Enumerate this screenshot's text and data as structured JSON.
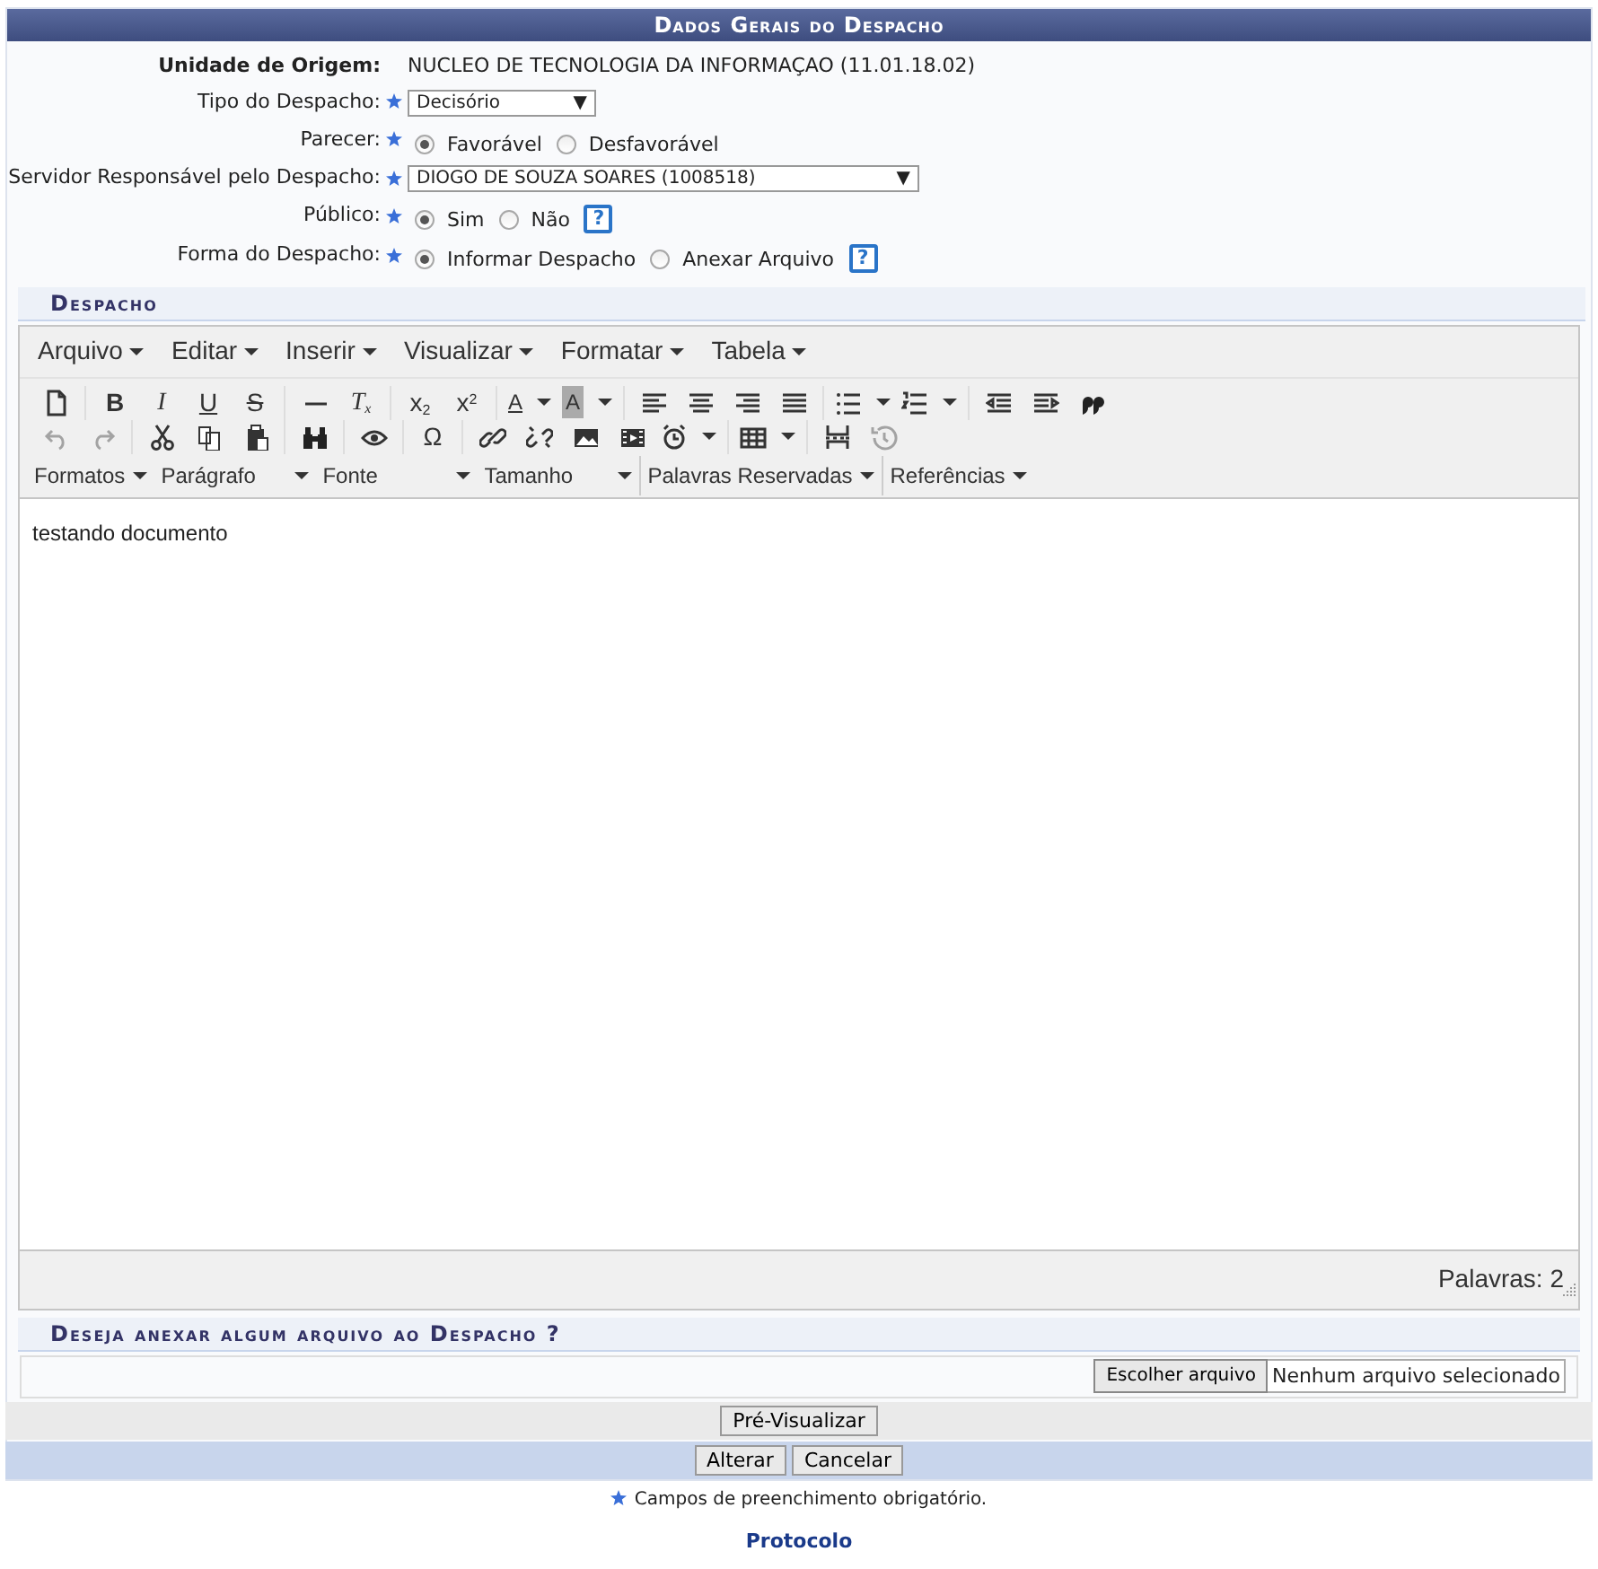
{
  "form_title": "Dados Gerais do Despacho",
  "fields": [
    {
      "label": "Unidade de Origem:",
      "kind": "text",
      "required": false,
      "value": "NUCLEO DE TECNOLOGIA DA INFORMAÇAO (11.01.18.02)"
    },
    {
      "label": "Tipo do Despacho:",
      "kind": "select",
      "required": true,
      "value": "Decisório",
      "arrow": "▼"
    },
    {
      "label": "Parecer:",
      "kind": "radio",
      "required": true,
      "options": [
        {
          "label": "Favorável",
          "selected": true
        },
        {
          "label": "Desfavorável",
          "selected": false
        }
      ],
      "help": false
    },
    {
      "label": "Servidor Responsável pelo Despacho:",
      "kind": "select",
      "required": true,
      "value": "DIOGO DE SOUZA SOARES (1008518)",
      "arrow": "▼"
    },
    {
      "label": "Público:",
      "kind": "radio",
      "required": true,
      "options": [
        {
          "label": "Sim",
          "selected": true
        },
        {
          "label": "Não",
          "selected": false
        }
      ],
      "help": true
    },
    {
      "label": "Forma do Despacho:",
      "kind": "radio",
      "required": true,
      "options": [
        {
          "label": "Informar Despacho",
          "selected": true
        },
        {
          "label": "Anexar Arquivo",
          "selected": false
        }
      ],
      "help": true
    }
  ],
  "help_mark": "?",
  "section_title": "Despacho",
  "editor": {
    "menubar": [
      "Arquivo",
      "Editar",
      "Inserir",
      "Visualizar",
      "Formatar",
      "Tabela"
    ],
    "toolbar_rows": [
      [
        [
          {
            "kind": "icon"
          }
        ],
        [
          {
            "kind": "glyph",
            "text": "B"
          },
          {
            "kind": "glyph",
            "text": "I"
          },
          {
            "kind": "glyph",
            "text": "U"
          },
          {
            "kind": "glyph",
            "text": "S"
          }
        ],
        [
          {
            "kind": "icon"
          },
          {
            "kind": "glyph",
            "text": "T$_{x}$"
          }
        ],
        [
          {
            "kind": "glyph",
            "text": "x$_{2}$"
          },
          {
            "kind": "glyph",
            "text": "x$^{2}$"
          }
        ],
        [
          {
            "kind": "glyph",
            "text": "A",
            "dropdown": true
          },
          {
            "kind": "glyph",
            "text": "A",
            "dropdown": true
          }
        ],
        [
          {
            "kind": "icon"
          },
          {
            "kind": "icon"
          },
          {
            "kind": "icon"
          },
          {
            "kind": "icon"
          }
        ],
        [
          {
            "kind": "icon",
            "dropdown": true
          },
          {
            "kind": "icon",
            "dropdown": true
          }
        ],
        [
          {
            "kind": "icon"
          },
          {
            "kind": "icon"
          },
          {
            "kind": "icon"
          }
        ]
      ],
      [
        [
          {
            "kind": "icon",
            "disabled": true
          },
          {
            "kind": "icon",
            "disabled": true
          }
        ],
        [
          {
            "kind": "icon"
          },
          {
            "kind": "icon"
          },
          {
            "kind": "icon"
          }
        ],
        [
          {
            "kind": "icon"
          }
        ],
        [
          {
            "kind": "icon"
          }
        ],
        [
          {
            "kind": "glyph",
            "text": "Ω"
          }
        ],
        [
          {
            "kind": "icon"
          },
          {
            "kind": "icon"
          },
          {
            "kind": "icon"
          },
          {
            "kind": "icon"
          },
          {
            "kind": "icon",
            "dropdown": true
          }
        ],
        [
          {
            "kind": "icon",
            "dropdown": true
          }
        ],
        [
          {
            "kind": "icon"
          },
          {
            "kind": "icon",
            "disabled": true
          }
        ]
      ]
    ],
    "format_selects": [
      {
        "label": "Formatos",
        "separator": false
      },
      {
        "label": "Parágrafo",
        "separator": false
      },
      {
        "label": "Fonte",
        "separator": false
      },
      {
        "label": "Tamanho",
        "separator": false
      },
      {
        "label": "Palavras Reservadas",
        "separator": true
      },
      {
        "label": "Referências",
        "separator": true
      }
    ],
    "content": "testando documento",
    "word_count": "Palavras: 2"
  },
  "attach_title": "Deseja anexar algum arquivo ao Despacho ?",
  "file_button": "Escolher arquivo",
  "file_status": "Nenhum arquivo selecionado",
  "preview_button": "Pré-Visualizar",
  "footer_buttons": [
    "Alterar",
    "Cancelar"
  ],
  "required_note": "Campos de preenchimento obrigatório.",
  "bottom_link": "Protocolo"
}
